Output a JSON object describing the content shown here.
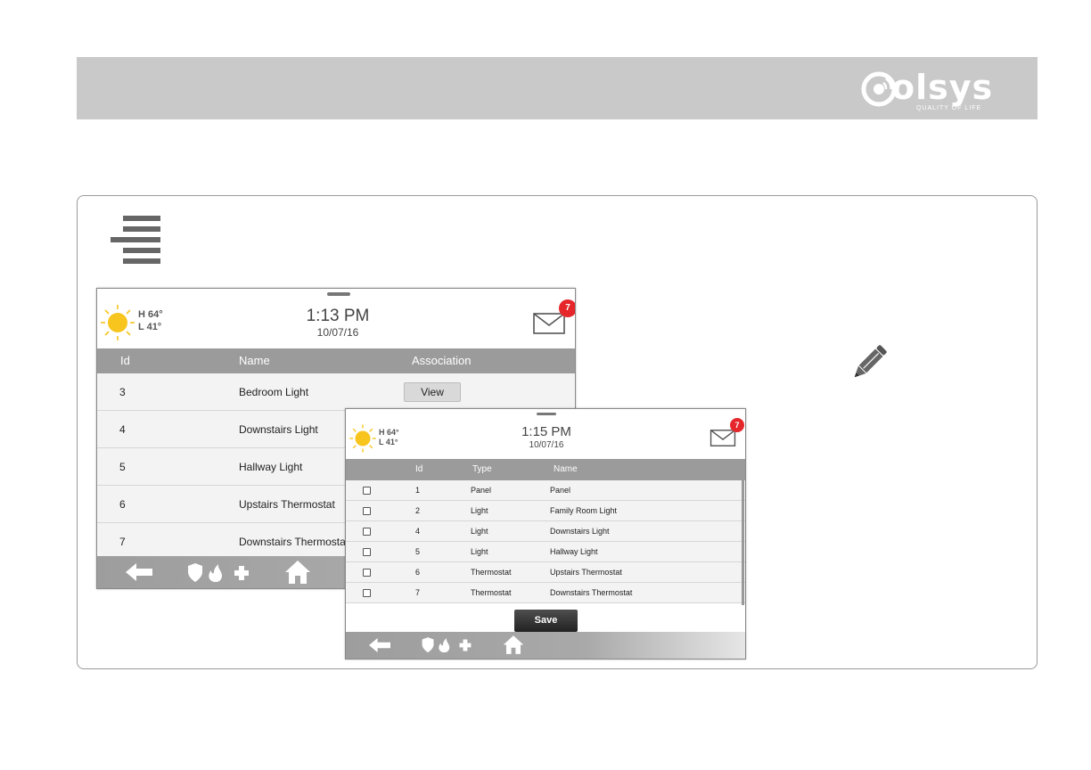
{
  "brand": {
    "logo_text": "olsys",
    "tagline": "QUALITY OF LIFE",
    "band_color": "#c9c9c9"
  },
  "icons": {
    "menu": "menu-lines-icon",
    "edit": "pencil-icon"
  },
  "screen_a": {
    "weather": {
      "high": "H 64°",
      "low": "L 41°"
    },
    "time": "1:13 PM",
    "date": "10/07/16",
    "messages_badge": "7",
    "table": {
      "headers": [
        "Id",
        "Name",
        "Association"
      ],
      "rows": [
        {
          "id": "3",
          "name": "Bedroom Light",
          "action": "View"
        },
        {
          "id": "4",
          "name": "Downstairs Light"
        },
        {
          "id": "5",
          "name": "Hallway Light"
        },
        {
          "id": "6",
          "name": "Upstairs Thermostat"
        },
        {
          "id": "7",
          "name": "Downstairs Thermostat"
        }
      ]
    }
  },
  "screen_b": {
    "weather": {
      "high": "H 64°",
      "low": "L 41°"
    },
    "time": "1:15 PM",
    "date": "10/07/16",
    "messages_badge": "7",
    "table": {
      "headers": [
        "Id",
        "Type",
        "Name"
      ],
      "rows": [
        {
          "id": "1",
          "type": "Panel",
          "name": "Panel"
        },
        {
          "id": "2",
          "type": "Light",
          "name": "Family Room Light"
        },
        {
          "id": "4",
          "type": "Light",
          "name": "Downstairs Light"
        },
        {
          "id": "5",
          "type": "Light",
          "name": "Hallway Light"
        },
        {
          "id": "6",
          "type": "Thermostat",
          "name": "Upstairs Thermostat"
        },
        {
          "id": "7",
          "type": "Thermostat",
          "name": "Downstairs Thermostat"
        }
      ]
    },
    "save_label": "Save"
  },
  "colors": {
    "accent_red": "#e5262b",
    "sun_yellow": "#f7c51e",
    "header_gray": "#9b9b9b"
  }
}
